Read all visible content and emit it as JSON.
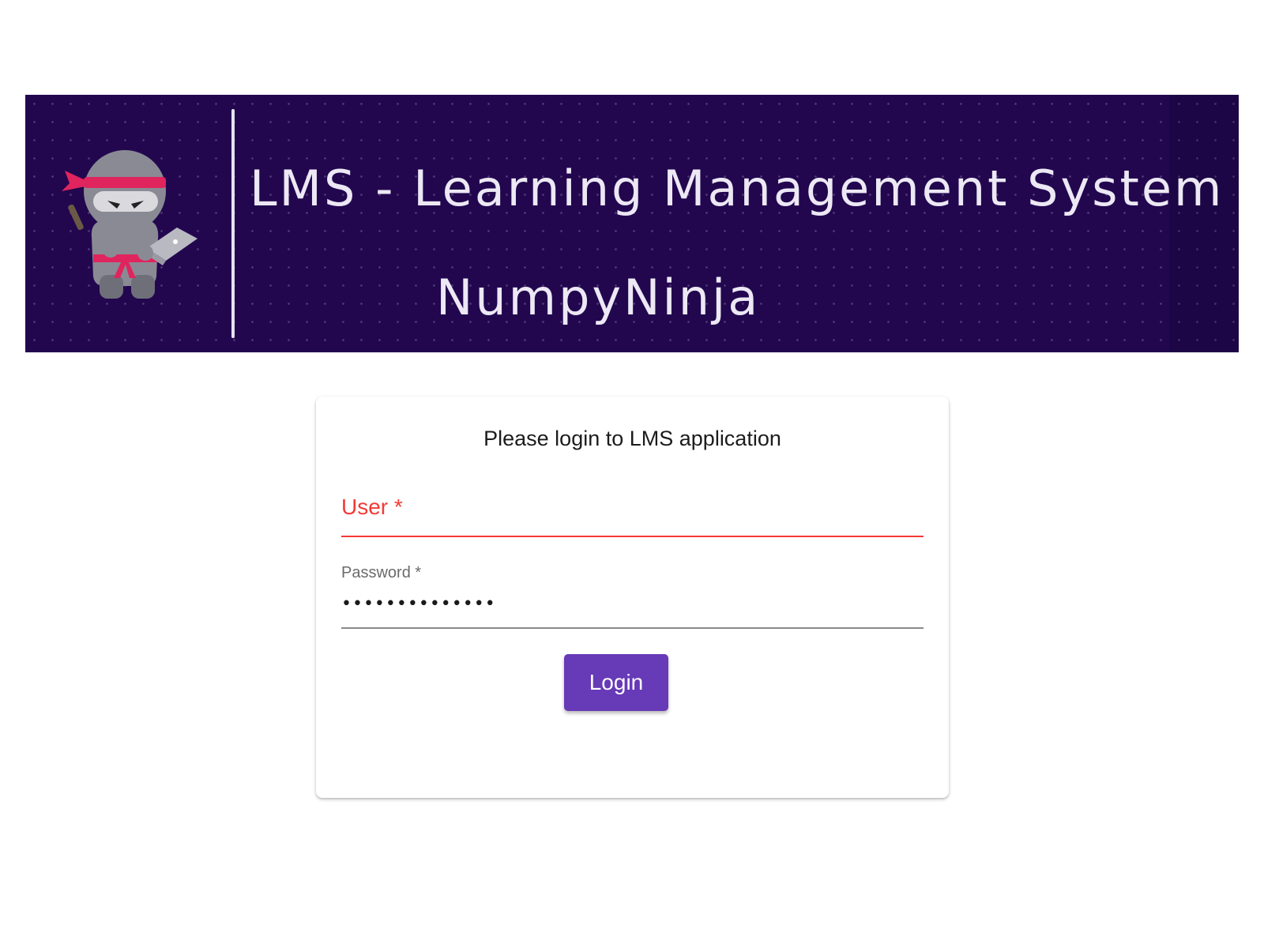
{
  "banner": {
    "title": "LMS - Learning Management System",
    "subtitle": "NumpyNinja"
  },
  "login": {
    "heading": "Please login to LMS application",
    "user_label": "User *",
    "password_label": "Password *",
    "password_value": "••••••••••••••",
    "button_label": "Login"
  },
  "colors": {
    "banner_bg": "#22074f",
    "error": "#f43a35",
    "primary": "#673ab7"
  }
}
